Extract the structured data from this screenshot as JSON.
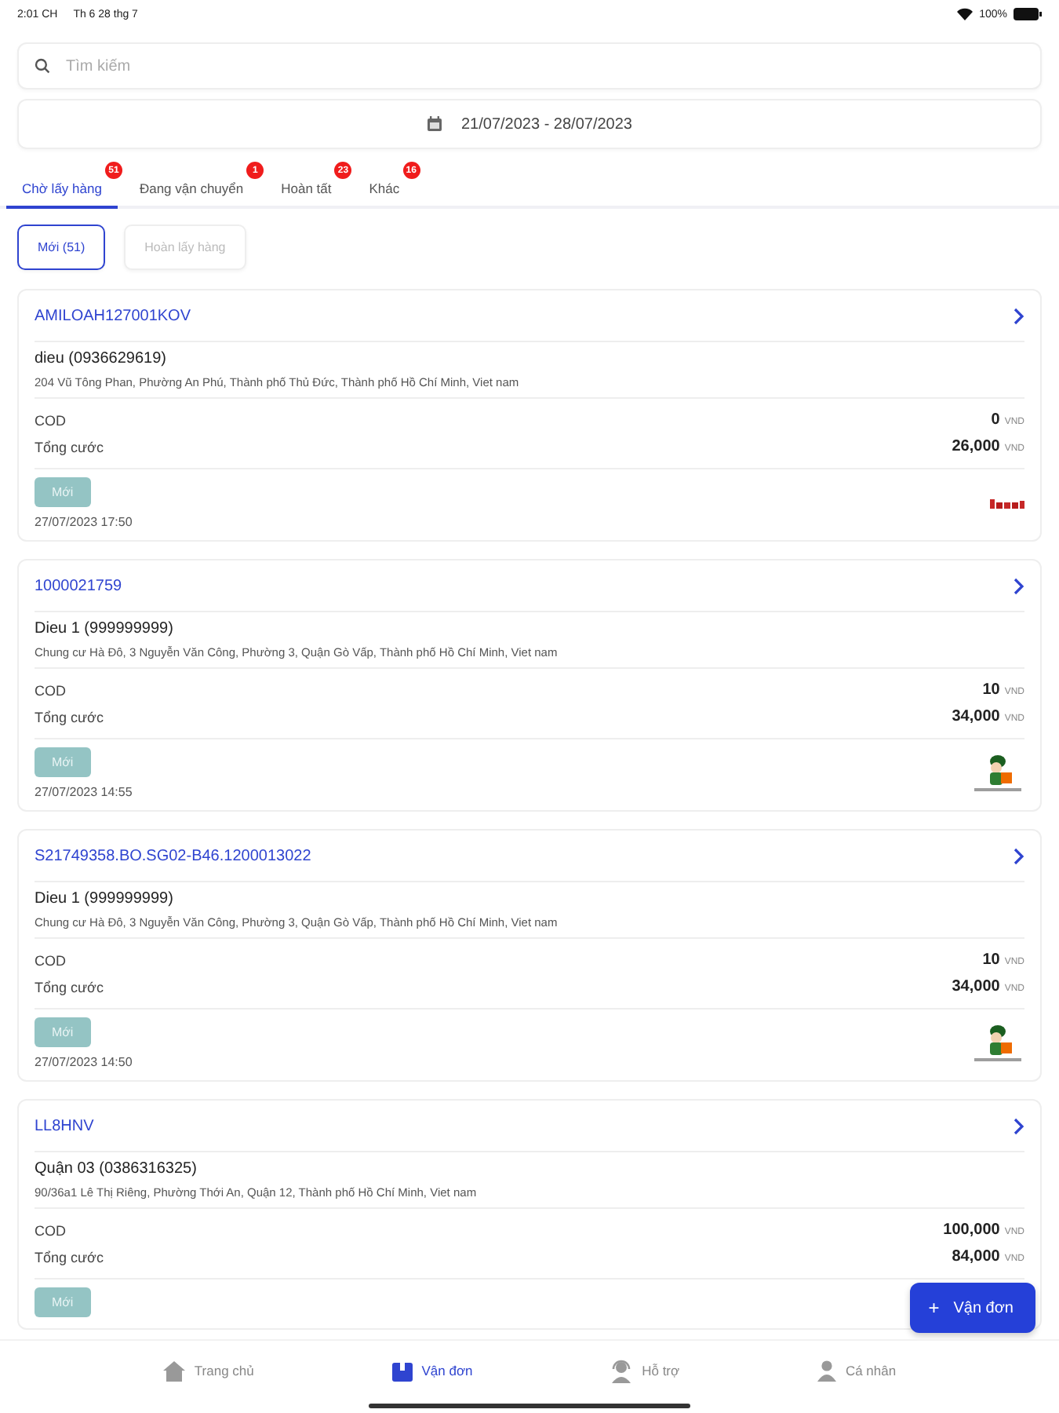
{
  "status_bar": {
    "time": "2:01 CH",
    "date": "Th 6 28 thg 7",
    "battery": "100%"
  },
  "search": {
    "placeholder": "Tìm kiếm"
  },
  "date_range": "21/07/2023 - 28/07/2023",
  "tabs": [
    {
      "label": "Chờ lấy hàng",
      "badge": "51",
      "selected": true
    },
    {
      "label": "Đang vận chuyển",
      "badge": "1",
      "selected": false
    },
    {
      "label": "Hoàn tất",
      "badge": "23",
      "selected": false
    },
    {
      "label": "Khác",
      "badge": "16",
      "selected": false
    }
  ],
  "filters": [
    {
      "label": "Mới (51)",
      "selected": true
    },
    {
      "label": "Hoàn lấy hàng",
      "selected": false
    }
  ],
  "orders": [
    {
      "code": "AMILOAH127001KOV",
      "recipient": "dieu (0936629619)",
      "address": "204 Vũ Tông Phan, Phường An Phú, Thành phố Thủ Đức, Thành phố Hồ Chí Minh, Viet nam",
      "cod_label": "COD",
      "cod": "0",
      "cod_unit": "VND",
      "fee_label": "Tổng cước",
      "fee": "26,000",
      "fee_unit": "VND",
      "status": "Mới",
      "time": "27/07/2023 17:50",
      "logo": {
        "kind": "wordmark"
      }
    },
    {
      "code": "1000021759",
      "recipient": "Dieu 1 (999999999)",
      "address": "Chung cư Hà Đô, 3 Nguyễn Văn Công, Phường 3, Quận Gò Vấp, Thành phố Hồ Chí Minh, Viet nam",
      "cod_label": "COD",
      "cod": "10",
      "cod_unit": "VND",
      "fee_label": "Tổng cước",
      "fee": "34,000",
      "fee_unit": "VND",
      "status": "Mới",
      "time": "27/07/2023 14:55",
      "logo": {
        "kind": "mascot"
      }
    },
    {
      "code": "S21749358.BO.SG02-B46.1200013022",
      "recipient": "Dieu 1 (999999999)",
      "address": "Chung cư Hà Đô, 3 Nguyễn Văn Công, Phường 3, Quận Gò Vấp, Thành phố Hồ Chí Minh, Viet nam",
      "cod_label": "COD",
      "cod": "10",
      "cod_unit": "VND",
      "fee_label": "Tổng cước",
      "fee": "34,000",
      "fee_unit": "VND",
      "status": "Mới",
      "time": "27/07/2023 14:50",
      "logo": {
        "kind": "mascot"
      }
    },
    {
      "code": "LL8HNV",
      "recipient": "Quận 03 (0386316325)",
      "address": "90/36a1 Lê Thị Riêng, Phường Thới An, Quận 12, Thành phố Hồ Chí Minh, Viet nam",
      "cod_label": "COD",
      "cod": "100,000",
      "cod_unit": "VND",
      "fee_label": "Tổng cước",
      "fee": "84,000",
      "fee_unit": "VND",
      "status": "Mới"
    }
  ],
  "fab": {
    "icon": "+",
    "label": "Vận đơn"
  },
  "nav": [
    {
      "label": "Trang chủ",
      "selected": false
    },
    {
      "label": "Vận đơn",
      "selected": true
    },
    {
      "label": "Hỗ trợ",
      "selected": false
    },
    {
      "label": "Cá nhân",
      "selected": false
    }
  ]
}
